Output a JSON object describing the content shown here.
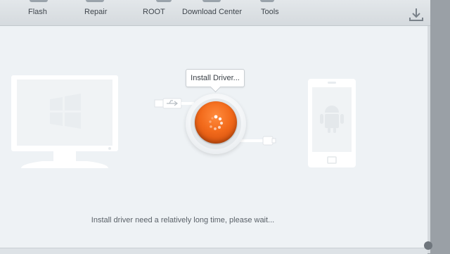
{
  "toolbar": {
    "items": [
      {
        "label": "Flash",
        "icon": "flash-icon"
      },
      {
        "label": "Repair",
        "icon": "repair-icon"
      },
      {
        "label": "ROOT",
        "icon": "root-icon"
      },
      {
        "label": "Download Center",
        "icon": "download-center-icon"
      },
      {
        "label": "Tools",
        "icon": "tools-icon"
      }
    ],
    "download_icon": "download-icon"
  },
  "main": {
    "status_bubble": "Install Driver...",
    "message": "Install driver need a relatively long time, please wait...",
    "icons": [
      "windows-monitor-icon",
      "usb-plug-icon",
      "spinner-icon",
      "usb-cable-icon",
      "android-phone-icon"
    ]
  },
  "colors": {
    "accent": "#f26a1b",
    "toolbar_bg": "#d9dee2",
    "panel_bg": "#eef2f5",
    "graphic_white": "#ffffff"
  }
}
